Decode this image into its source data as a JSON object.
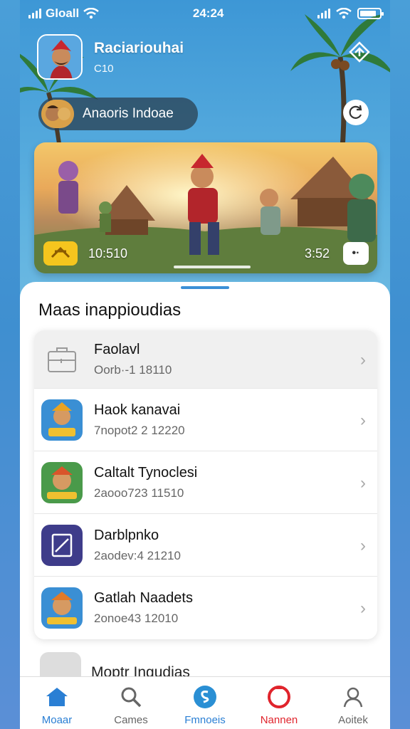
{
  "status_bar": {
    "carrier": "Gloall",
    "time": "24:24"
  },
  "profile": {
    "name": "Raciariouhai",
    "subtitle": "C10"
  },
  "pill": {
    "label": "Anaoris Indoae"
  },
  "banner": {
    "time_left": "10:510",
    "time_right": "3:52",
    "control": "•·"
  },
  "section": {
    "title": "Maas inappioudias"
  },
  "rows": [
    {
      "title": "Faolavl",
      "subtitle": "Oorb·-1 18110",
      "icon": "briefcase-icon"
    },
    {
      "title": "Haok kanavai",
      "subtitle": "7nopot2 2  12220",
      "icon": "game-icon"
    },
    {
      "title": "Caltalt Tynoclesi",
      "subtitle": "2aooo723  11510",
      "icon": "game-icon"
    },
    {
      "title": "Darblpnko",
      "subtitle": "2aodev:4  21210",
      "icon": "tablet-icon"
    },
    {
      "title": "Gatlah Naadets",
      "subtitle": "2onoe43  12010",
      "icon": "game-icon"
    }
  ],
  "partial_row": {
    "title": "Moptr Ingudias"
  },
  "tabs": [
    {
      "label": "Moaar",
      "color": "#2a7fd4",
      "icon": "home-icon"
    },
    {
      "label": "Cames",
      "color": "#666666",
      "icon": "search-icon"
    },
    {
      "label": "Fmnoeis",
      "color": "#2a7fd4",
      "icon": "finance-icon"
    },
    {
      "label": "Nannen",
      "color": "#e0242c",
      "icon": "record-icon"
    },
    {
      "label": "Aoitek",
      "color": "#666666",
      "icon": "person-icon"
    }
  ],
  "colors": {
    "accent": "#2a7fd4",
    "alert": "#e0242c",
    "badge": "#f5c51e"
  }
}
